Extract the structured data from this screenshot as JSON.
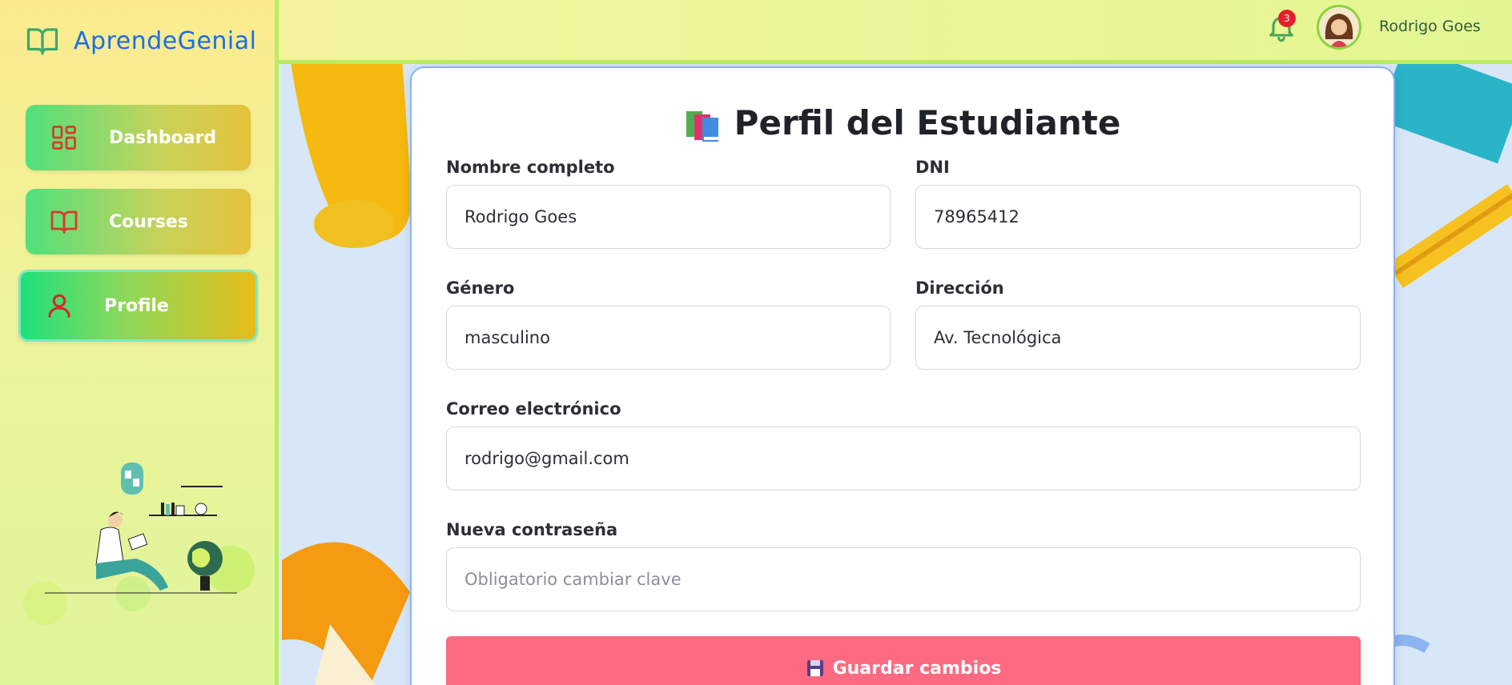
{
  "brand": {
    "name": "AprendeGenial",
    "icon": "book-open-icon",
    "color": "#1a6ee8"
  },
  "sidebar": {
    "items": [
      {
        "label": "Dashboard",
        "icon": "dashboard-grid-icon",
        "active": false
      },
      {
        "label": "Courses",
        "icon": "book-icon",
        "active": false
      },
      {
        "label": "Profile",
        "icon": "user-icon",
        "active": true
      }
    ]
  },
  "topbar": {
    "notifications": {
      "icon": "bell-icon",
      "count": "3"
    },
    "user": {
      "name": "Rodrigo Goes",
      "avatar": "avatar"
    }
  },
  "profile": {
    "title": "Perfil del Estudiante",
    "fields": {
      "nombre": {
        "label": "Nombre completo",
        "value": "Rodrigo Goes"
      },
      "dni": {
        "label": "DNI",
        "value": "78965412"
      },
      "genero": {
        "label": "Género",
        "value": "masculino"
      },
      "direccion": {
        "label": "Dirección",
        "value": "Av. Tecnológica"
      },
      "correo": {
        "label": "Correo electrónico",
        "value": "rodrigo@gmail.com"
      },
      "password": {
        "label": "Nueva contraseña",
        "value": "",
        "placeholder": "Obligatorio cambiar clave"
      }
    },
    "save_label": "Guardar cambios"
  },
  "colors": {
    "accent_button": "#fd6a82",
    "sidebar_border": "#b9ec60"
  }
}
